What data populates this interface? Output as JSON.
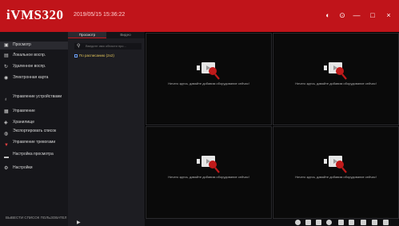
{
  "app": {
    "logo": "iVMS320",
    "datetime": "2019/05/15 15:36:22"
  },
  "window_controls": {
    "a": "◐",
    "b": "⊙",
    "minimize": "—",
    "maximize": "□",
    "close": "×"
  },
  "sidebar": {
    "items": [
      {
        "label": "Просмотр",
        "icon": "monitor-icon"
      },
      {
        "label": "Локальное воспр.",
        "icon": "local-playback-icon"
      },
      {
        "label": "Удаленное воспр.",
        "icon": "remote-playback-icon"
      },
      {
        "label": "Электронная карта",
        "icon": "map-icon"
      },
      {
        "label": "Управление устройствами",
        "icon": "device-icon"
      },
      {
        "label": "Управление",
        "icon": "manage-icon"
      },
      {
        "label": "Хранилище",
        "icon": "storage-icon"
      },
      {
        "label": "Экспортировать список",
        "icon": "export-icon"
      },
      {
        "label": "Управление тревогами",
        "icon": "alarm-icon"
      },
      {
        "label": "Настройка просмотра",
        "icon": "view-settings-icon"
      },
      {
        "label": "Настройки",
        "icon": "settings-icon"
      }
    ],
    "logout_label": "ВЫВЕСТИ СПИСОК ПОЛЬЗОВАТЕЛ"
  },
  "panel": {
    "tabs": [
      "Просмотр",
      "Видео"
    ],
    "search_placeholder": "Введите имя области про...",
    "tree_item": "По расписанию (2x2)"
  },
  "grid": {
    "empty_message": "Ничего здесь, давайте добавим оборудование сейчас!",
    "cells": 4
  }
}
